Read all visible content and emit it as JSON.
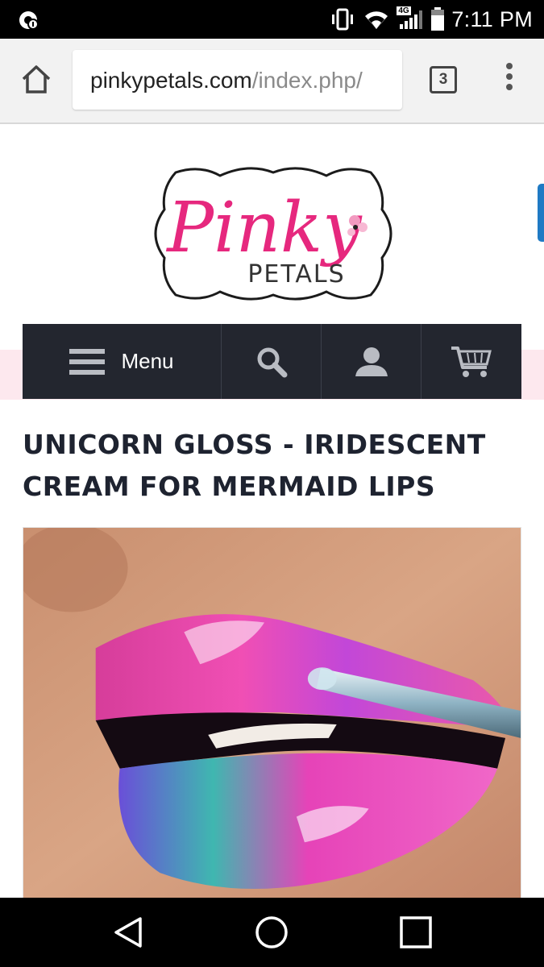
{
  "status_bar": {
    "time": "7:11 PM",
    "network": "4G",
    "icons": [
      "notification-icon",
      "vibrate-icon",
      "wifi-icon",
      "signal-icon",
      "battery-icon"
    ]
  },
  "browser": {
    "url_domain": "pinkypetals.com",
    "url_path": "/index.php/",
    "tab_count": "3"
  },
  "site": {
    "logo_text_main": "Pinky",
    "logo_text_sub": "PETALS",
    "brand_color": "#e6287e",
    "nav_bg": "#23262f"
  },
  "nav": {
    "menu_label": "Menu",
    "icons": [
      "menu-icon",
      "search-icon",
      "account-icon",
      "cart-icon"
    ]
  },
  "product": {
    "title": "UNICORN GLOSS - IRIDESCENT CREAM FOR MERMAID LIPS"
  },
  "system_nav": {
    "icons": [
      "back-icon",
      "home-icon",
      "recents-icon"
    ]
  }
}
